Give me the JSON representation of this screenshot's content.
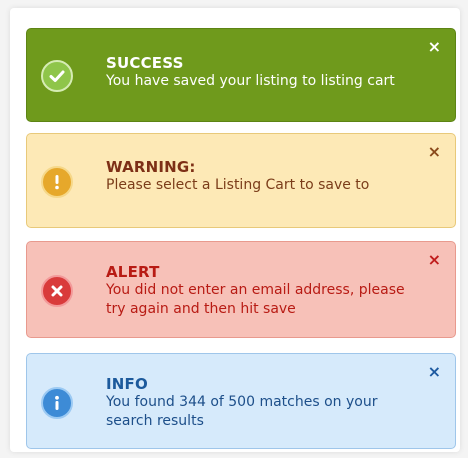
{
  "alerts": [
    {
      "type": "success",
      "title": "SUCCESS",
      "message": "You have saved your listing to listing cart",
      "icon": "check-icon",
      "close": "×",
      "color": "#6f9a1c"
    },
    {
      "type": "warning",
      "title": "WARNING:",
      "message": "Please select a Listing Cart to save to",
      "icon": "exclamation-icon",
      "close": "×",
      "color": "#fde9b6"
    },
    {
      "type": "alert",
      "title": "ALERT",
      "message": "You did not enter an email address, please try again and then hit save",
      "icon": "x-icon",
      "close": "×",
      "color": "#f7c1b8"
    },
    {
      "type": "info",
      "title": "INFO",
      "message": "You found 344 of 500 matches on your search results",
      "icon": "info-icon",
      "close": "×",
      "color": "#d6eafb"
    }
  ]
}
